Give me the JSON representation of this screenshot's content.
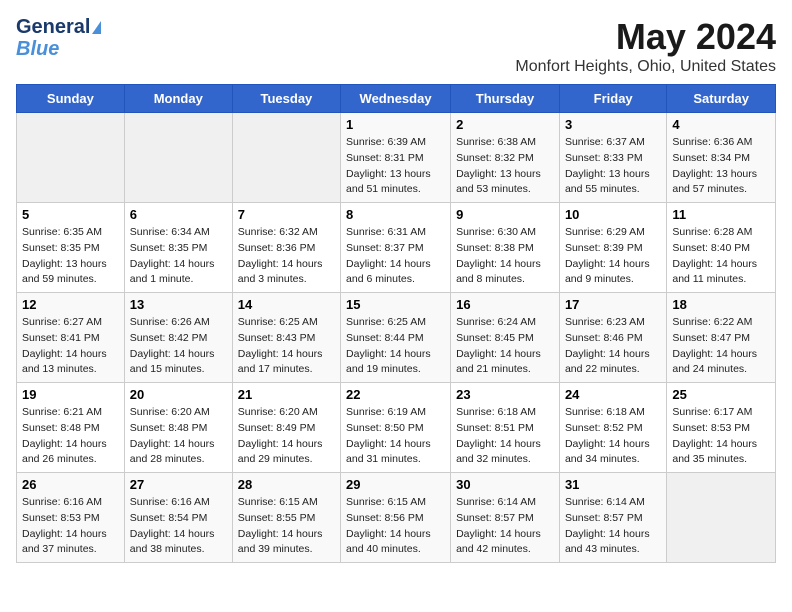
{
  "logo": {
    "line1": "General",
    "line2": "Blue"
  },
  "title": "May 2024",
  "subtitle": "Monfort Heights, Ohio, United States",
  "days_of_week": [
    "Sunday",
    "Monday",
    "Tuesday",
    "Wednesday",
    "Thursday",
    "Friday",
    "Saturday"
  ],
  "weeks": [
    [
      {
        "day": "",
        "info": ""
      },
      {
        "day": "",
        "info": ""
      },
      {
        "day": "",
        "info": ""
      },
      {
        "day": "1",
        "info": "Sunrise: 6:39 AM\nSunset: 8:31 PM\nDaylight: 13 hours\nand 51 minutes."
      },
      {
        "day": "2",
        "info": "Sunrise: 6:38 AM\nSunset: 8:32 PM\nDaylight: 13 hours\nand 53 minutes."
      },
      {
        "day": "3",
        "info": "Sunrise: 6:37 AM\nSunset: 8:33 PM\nDaylight: 13 hours\nand 55 minutes."
      },
      {
        "day": "4",
        "info": "Sunrise: 6:36 AM\nSunset: 8:34 PM\nDaylight: 13 hours\nand 57 minutes."
      }
    ],
    [
      {
        "day": "5",
        "info": "Sunrise: 6:35 AM\nSunset: 8:35 PM\nDaylight: 13 hours\nand 59 minutes."
      },
      {
        "day": "6",
        "info": "Sunrise: 6:34 AM\nSunset: 8:35 PM\nDaylight: 14 hours\nand 1 minute."
      },
      {
        "day": "7",
        "info": "Sunrise: 6:32 AM\nSunset: 8:36 PM\nDaylight: 14 hours\nand 3 minutes."
      },
      {
        "day": "8",
        "info": "Sunrise: 6:31 AM\nSunset: 8:37 PM\nDaylight: 14 hours\nand 6 minutes."
      },
      {
        "day": "9",
        "info": "Sunrise: 6:30 AM\nSunset: 8:38 PM\nDaylight: 14 hours\nand 8 minutes."
      },
      {
        "day": "10",
        "info": "Sunrise: 6:29 AM\nSunset: 8:39 PM\nDaylight: 14 hours\nand 9 minutes."
      },
      {
        "day": "11",
        "info": "Sunrise: 6:28 AM\nSunset: 8:40 PM\nDaylight: 14 hours\nand 11 minutes."
      }
    ],
    [
      {
        "day": "12",
        "info": "Sunrise: 6:27 AM\nSunset: 8:41 PM\nDaylight: 14 hours\nand 13 minutes."
      },
      {
        "day": "13",
        "info": "Sunrise: 6:26 AM\nSunset: 8:42 PM\nDaylight: 14 hours\nand 15 minutes."
      },
      {
        "day": "14",
        "info": "Sunrise: 6:25 AM\nSunset: 8:43 PM\nDaylight: 14 hours\nand 17 minutes."
      },
      {
        "day": "15",
        "info": "Sunrise: 6:25 AM\nSunset: 8:44 PM\nDaylight: 14 hours\nand 19 minutes."
      },
      {
        "day": "16",
        "info": "Sunrise: 6:24 AM\nSunset: 8:45 PM\nDaylight: 14 hours\nand 21 minutes."
      },
      {
        "day": "17",
        "info": "Sunrise: 6:23 AM\nSunset: 8:46 PM\nDaylight: 14 hours\nand 22 minutes."
      },
      {
        "day": "18",
        "info": "Sunrise: 6:22 AM\nSunset: 8:47 PM\nDaylight: 14 hours\nand 24 minutes."
      }
    ],
    [
      {
        "day": "19",
        "info": "Sunrise: 6:21 AM\nSunset: 8:48 PM\nDaylight: 14 hours\nand 26 minutes."
      },
      {
        "day": "20",
        "info": "Sunrise: 6:20 AM\nSunset: 8:48 PM\nDaylight: 14 hours\nand 28 minutes."
      },
      {
        "day": "21",
        "info": "Sunrise: 6:20 AM\nSunset: 8:49 PM\nDaylight: 14 hours\nand 29 minutes."
      },
      {
        "day": "22",
        "info": "Sunrise: 6:19 AM\nSunset: 8:50 PM\nDaylight: 14 hours\nand 31 minutes."
      },
      {
        "day": "23",
        "info": "Sunrise: 6:18 AM\nSunset: 8:51 PM\nDaylight: 14 hours\nand 32 minutes."
      },
      {
        "day": "24",
        "info": "Sunrise: 6:18 AM\nSunset: 8:52 PM\nDaylight: 14 hours\nand 34 minutes."
      },
      {
        "day": "25",
        "info": "Sunrise: 6:17 AM\nSunset: 8:53 PM\nDaylight: 14 hours\nand 35 minutes."
      }
    ],
    [
      {
        "day": "26",
        "info": "Sunrise: 6:16 AM\nSunset: 8:53 PM\nDaylight: 14 hours\nand 37 minutes."
      },
      {
        "day": "27",
        "info": "Sunrise: 6:16 AM\nSunset: 8:54 PM\nDaylight: 14 hours\nand 38 minutes."
      },
      {
        "day": "28",
        "info": "Sunrise: 6:15 AM\nSunset: 8:55 PM\nDaylight: 14 hours\nand 39 minutes."
      },
      {
        "day": "29",
        "info": "Sunrise: 6:15 AM\nSunset: 8:56 PM\nDaylight: 14 hours\nand 40 minutes."
      },
      {
        "day": "30",
        "info": "Sunrise: 6:14 AM\nSunset: 8:57 PM\nDaylight: 14 hours\nand 42 minutes."
      },
      {
        "day": "31",
        "info": "Sunrise: 6:14 AM\nSunset: 8:57 PM\nDaylight: 14 hours\nand 43 minutes."
      },
      {
        "day": "",
        "info": ""
      }
    ]
  ]
}
